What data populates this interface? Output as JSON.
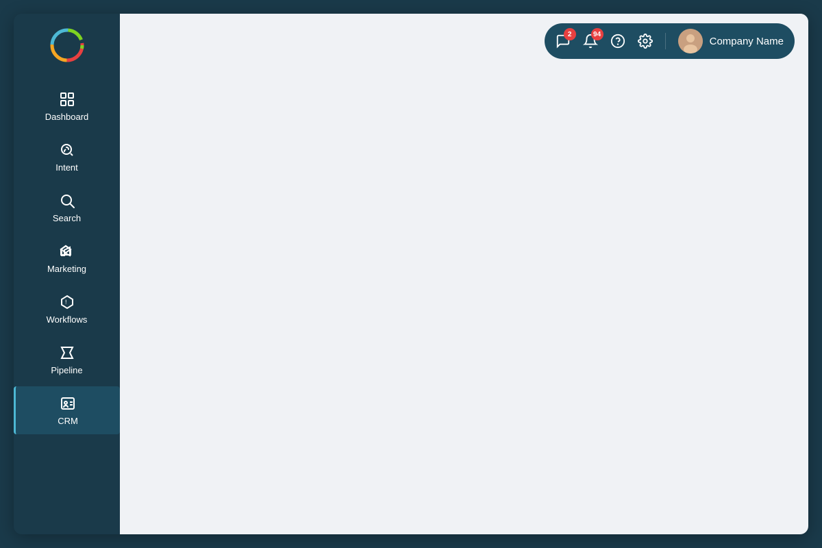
{
  "sidebar": {
    "logo_alt": "App Logo",
    "items": [
      {
        "id": "dashboard",
        "label": "Dashboard",
        "icon": "dashboard-icon",
        "active": false
      },
      {
        "id": "intent",
        "label": "Intent",
        "icon": "intent-icon",
        "active": false
      },
      {
        "id": "search",
        "label": "Search",
        "icon": "search-icon",
        "active": false
      },
      {
        "id": "marketing",
        "label": "Marketing",
        "icon": "marketing-icon",
        "active": false
      },
      {
        "id": "workflows",
        "label": "Workflows",
        "icon": "workflows-icon",
        "active": false
      },
      {
        "id": "pipeline",
        "label": "Pipeline",
        "icon": "pipeline-icon",
        "active": false
      },
      {
        "id": "crm",
        "label": "CRM",
        "icon": "crm-icon",
        "active": true
      }
    ]
  },
  "topbar": {
    "messages_badge": "2",
    "notifications_badge": "94",
    "company_name": "Company Name"
  }
}
